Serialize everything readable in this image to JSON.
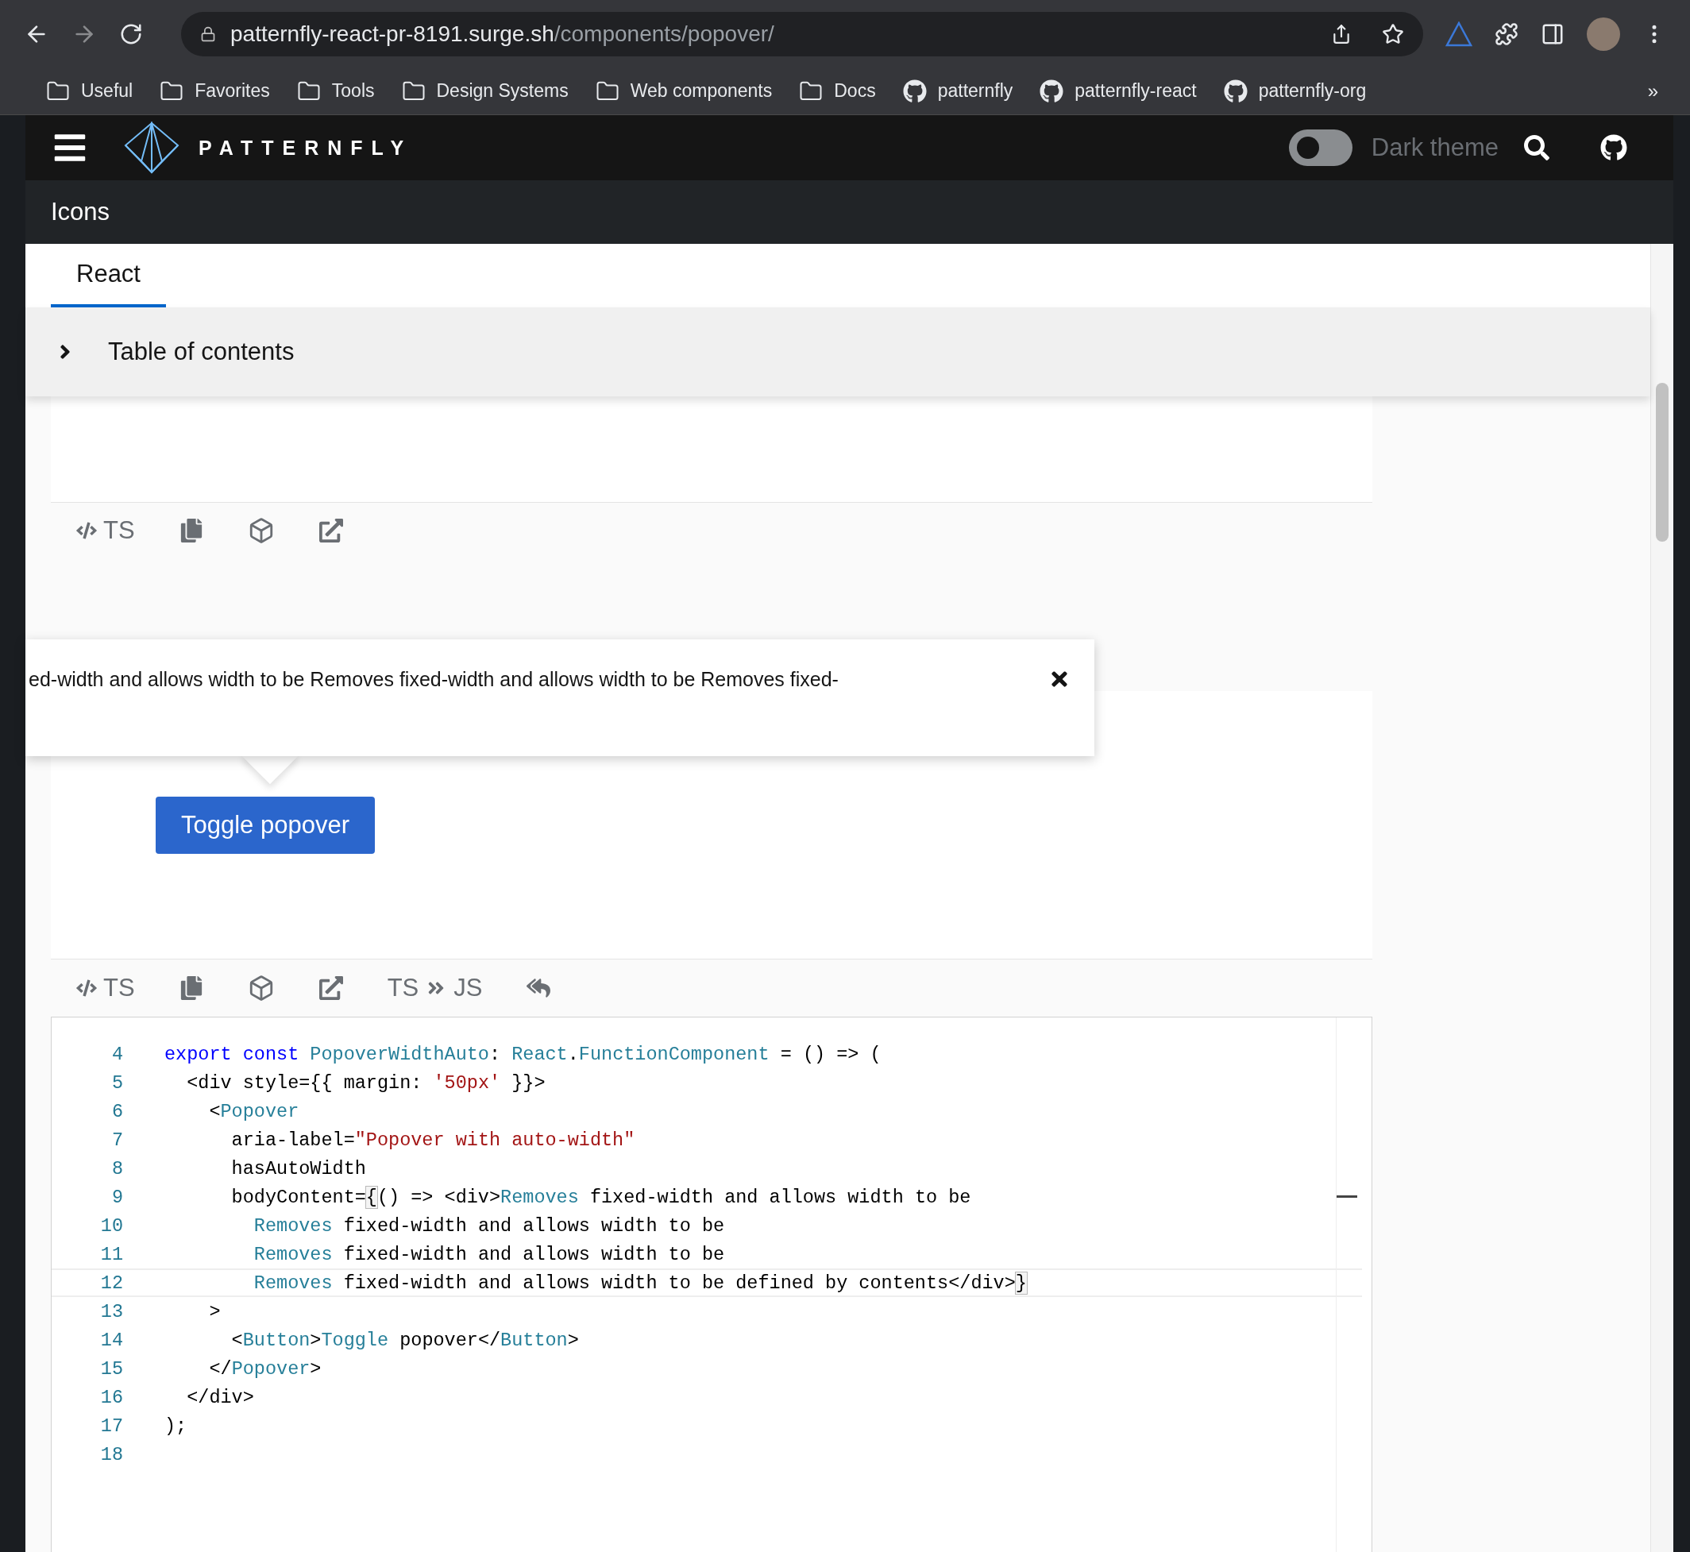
{
  "browser": {
    "url": {
      "host": "patternfly-react-pr-8191.surge.sh",
      "path": "/components/popover/"
    },
    "bookmarks": [
      {
        "label": "Useful",
        "kind": "folder"
      },
      {
        "label": "Favorites",
        "kind": "folder"
      },
      {
        "label": "Tools",
        "kind": "folder"
      },
      {
        "label": "Design Systems",
        "kind": "folder"
      },
      {
        "label": "Web components",
        "kind": "folder"
      },
      {
        "label": "Docs",
        "kind": "folder"
      },
      {
        "label": "patternfly",
        "kind": "github"
      },
      {
        "label": "patternfly-react",
        "kind": "github"
      },
      {
        "label": "patternfly-org",
        "kind": "github"
      }
    ],
    "overflow": "»"
  },
  "masthead": {
    "brand": "PATTERNFLY",
    "theme_toggle": {
      "label": "Dark theme",
      "on": false
    }
  },
  "section_bar": {
    "title": "Icons"
  },
  "tabs": [
    {
      "label": "React",
      "selected": true
    }
  ],
  "toc": {
    "label": "Table of contents",
    "expanded": false
  },
  "examples": [
    {
      "toolbar": [
        {
          "kind": "code",
          "label": "TS"
        },
        {
          "kind": "copy"
        },
        {
          "kind": "sandbox"
        },
        {
          "kind": "external"
        }
      ]
    },
    {
      "popover": {
        "text": "ed-width and allows width to be Removes fixed-width and allows width to be Removes fixed-"
      },
      "button": "Toggle popover",
      "toolbar": [
        {
          "kind": "code",
          "label": "TS"
        },
        {
          "kind": "copy"
        },
        {
          "kind": "sandbox"
        },
        {
          "kind": "external"
        },
        {
          "kind": "convert",
          "from": "TS",
          "to": "JS"
        },
        {
          "kind": "undo"
        }
      ],
      "code": [
        {
          "number": "4",
          "current": false,
          "tokens": [
            {
              "kind": "keyword",
              "text": "export const"
            },
            {
              "kind": "type",
              "text": " PopoverWidthAuto"
            },
            {
              "kind": "plain",
              "text": ": "
            },
            {
              "kind": "type",
              "text": "React"
            },
            {
              "kind": "plain",
              "text": "."
            },
            {
              "kind": "type",
              "text": "FunctionComponent"
            },
            {
              "kind": "plain",
              "text": " = () => ("
            }
          ]
        },
        {
          "number": "5",
          "current": false,
          "tokens": [
            {
              "kind": "plain",
              "text": "  <div style={{ margin: "
            },
            {
              "kind": "string",
              "text": "'50px'"
            },
            {
              "kind": "plain",
              "text": " }}>"
            }
          ]
        },
        {
          "number": "6",
          "current": false,
          "tokens": [
            {
              "kind": "plain",
              "text": "    <"
            },
            {
              "kind": "type",
              "text": "Popover"
            }
          ]
        },
        {
          "number": "7",
          "current": false,
          "tokens": [
            {
              "kind": "plain",
              "text": "      aria-label="
            },
            {
              "kind": "string",
              "text": "\"Popover with auto-width\""
            }
          ]
        },
        {
          "number": "8",
          "current": false,
          "tokens": [
            {
              "kind": "plain",
              "text": "      hasAutoWidth"
            }
          ]
        },
        {
          "number": "9",
          "current": false,
          "tokens": [
            {
              "kind": "plain",
              "text": "      bodyContent="
            },
            {
              "kind": "bracket",
              "text": "{"
            },
            {
              "kind": "plain",
              "text": "() => <div>"
            },
            {
              "kind": "type",
              "text": "Removes"
            },
            {
              "kind": "plain",
              "text": " fixed-width and allows width to be"
            }
          ]
        },
        {
          "number": "10",
          "current": false,
          "tokens": [
            {
              "kind": "type",
              "text": "        Removes"
            },
            {
              "kind": "plain",
              "text": " fixed-width and allows width to be"
            }
          ]
        },
        {
          "number": "11",
          "current": false,
          "tokens": [
            {
              "kind": "type",
              "text": "        Removes"
            },
            {
              "kind": "plain",
              "text": " fixed-width and allows width to be"
            }
          ]
        },
        {
          "number": "12",
          "current": true,
          "tokens": [
            {
              "kind": "type",
              "text": "        Removes"
            },
            {
              "kind": "plain",
              "text": " fixed-width and allows width to be defined by contents</div>"
            },
            {
              "kind": "bracket",
              "text": "}"
            }
          ]
        },
        {
          "number": "13",
          "current": false,
          "tokens": [
            {
              "kind": "plain",
              "text": "    >"
            }
          ]
        },
        {
          "number": "14",
          "current": false,
          "tokens": [
            {
              "kind": "plain",
              "text": "      <"
            },
            {
              "kind": "type",
              "text": "Button"
            },
            {
              "kind": "plain",
              "text": ">"
            },
            {
              "kind": "type",
              "text": "Toggle"
            },
            {
              "kind": "plain",
              "text": " popover</"
            },
            {
              "kind": "type",
              "text": "Button"
            },
            {
              "kind": "plain",
              "text": ">"
            }
          ]
        },
        {
          "number": "15",
          "current": false,
          "tokens": [
            {
              "kind": "plain",
              "text": "    </"
            },
            {
              "kind": "type",
              "text": "Popover"
            },
            {
              "kind": "plain",
              "text": ">"
            }
          ]
        },
        {
          "number": "16",
          "current": false,
          "tokens": [
            {
              "kind": "plain",
              "text": "  </div>"
            }
          ]
        },
        {
          "number": "17",
          "current": false,
          "tokens": [
            {
              "kind": "plain",
              "text": ");"
            }
          ]
        },
        {
          "number": "18",
          "current": false
        }
      ]
    }
  ]
}
